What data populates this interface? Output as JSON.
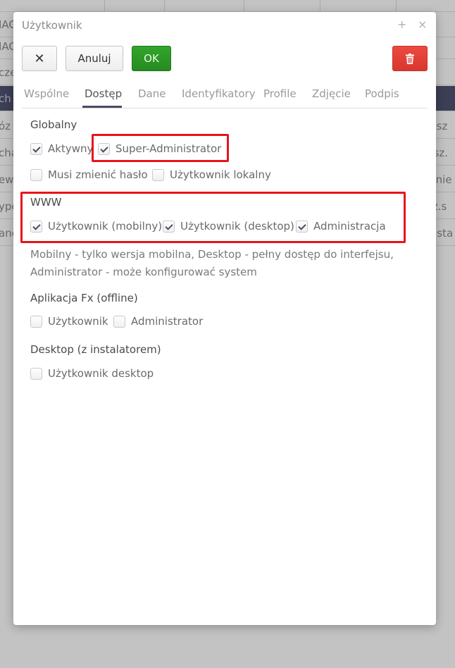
{
  "background": {
    "left_fragments": [
      "IAG",
      "IAG",
      "cze",
      "ch",
      "óz",
      "cha",
      "ewr",
      "ype",
      "anc"
    ],
    "right_fragments": [
      "iusz",
      "usz.",
      "z.nie",
      "sz.s",
      "d.sta"
    ]
  },
  "dialog": {
    "title": "Użytkownik",
    "title_icons": {
      "expand": "+",
      "close": "×"
    },
    "toolbar": {
      "close_label": "✕",
      "cancel_label": "Anuluj",
      "ok_label": "OK",
      "delete_icon": "trash-icon"
    },
    "tabs": [
      {
        "label": "Wspólne",
        "active": false
      },
      {
        "label": "Dostęp",
        "active": true
      },
      {
        "label": "Dane",
        "active": false
      },
      {
        "label": "Identyfikatory",
        "active": false
      },
      {
        "label": "Profile",
        "active": false
      },
      {
        "label": "Zdjęcie",
        "active": false
      },
      {
        "label": "Podpis",
        "active": false
      }
    ],
    "sections": {
      "global": {
        "title": "Globalny",
        "items": [
          {
            "label": "Aktywny",
            "checked": true
          },
          {
            "label": "Super-Administrator",
            "checked": true
          },
          {
            "label": "Musi zmienić hasło",
            "checked": false
          },
          {
            "label": "Użytkownik lokalny",
            "checked": false
          }
        ]
      },
      "www": {
        "title": "WWW",
        "items": [
          {
            "label": "Użytkownik (mobilny)",
            "checked": true
          },
          {
            "label": "Użytkownik (desktop)",
            "checked": true
          },
          {
            "label": "Administracja",
            "checked": true
          }
        ],
        "help_line1": "Mobilny - tylko wersja mobilna, Desktop - pełny dostęp do interfejsu,",
        "help_line2": "Administrator - może konfigurować system"
      },
      "fx": {
        "title": "Aplikacja Fx (offline)",
        "items": [
          {
            "label": "Użytkownik",
            "checked": false
          },
          {
            "label": "Administrator",
            "checked": false
          }
        ]
      },
      "desktop": {
        "title": "Desktop (z instalatorem)",
        "items": [
          {
            "label": "Użytkownik desktop",
            "checked": false
          }
        ]
      }
    }
  }
}
